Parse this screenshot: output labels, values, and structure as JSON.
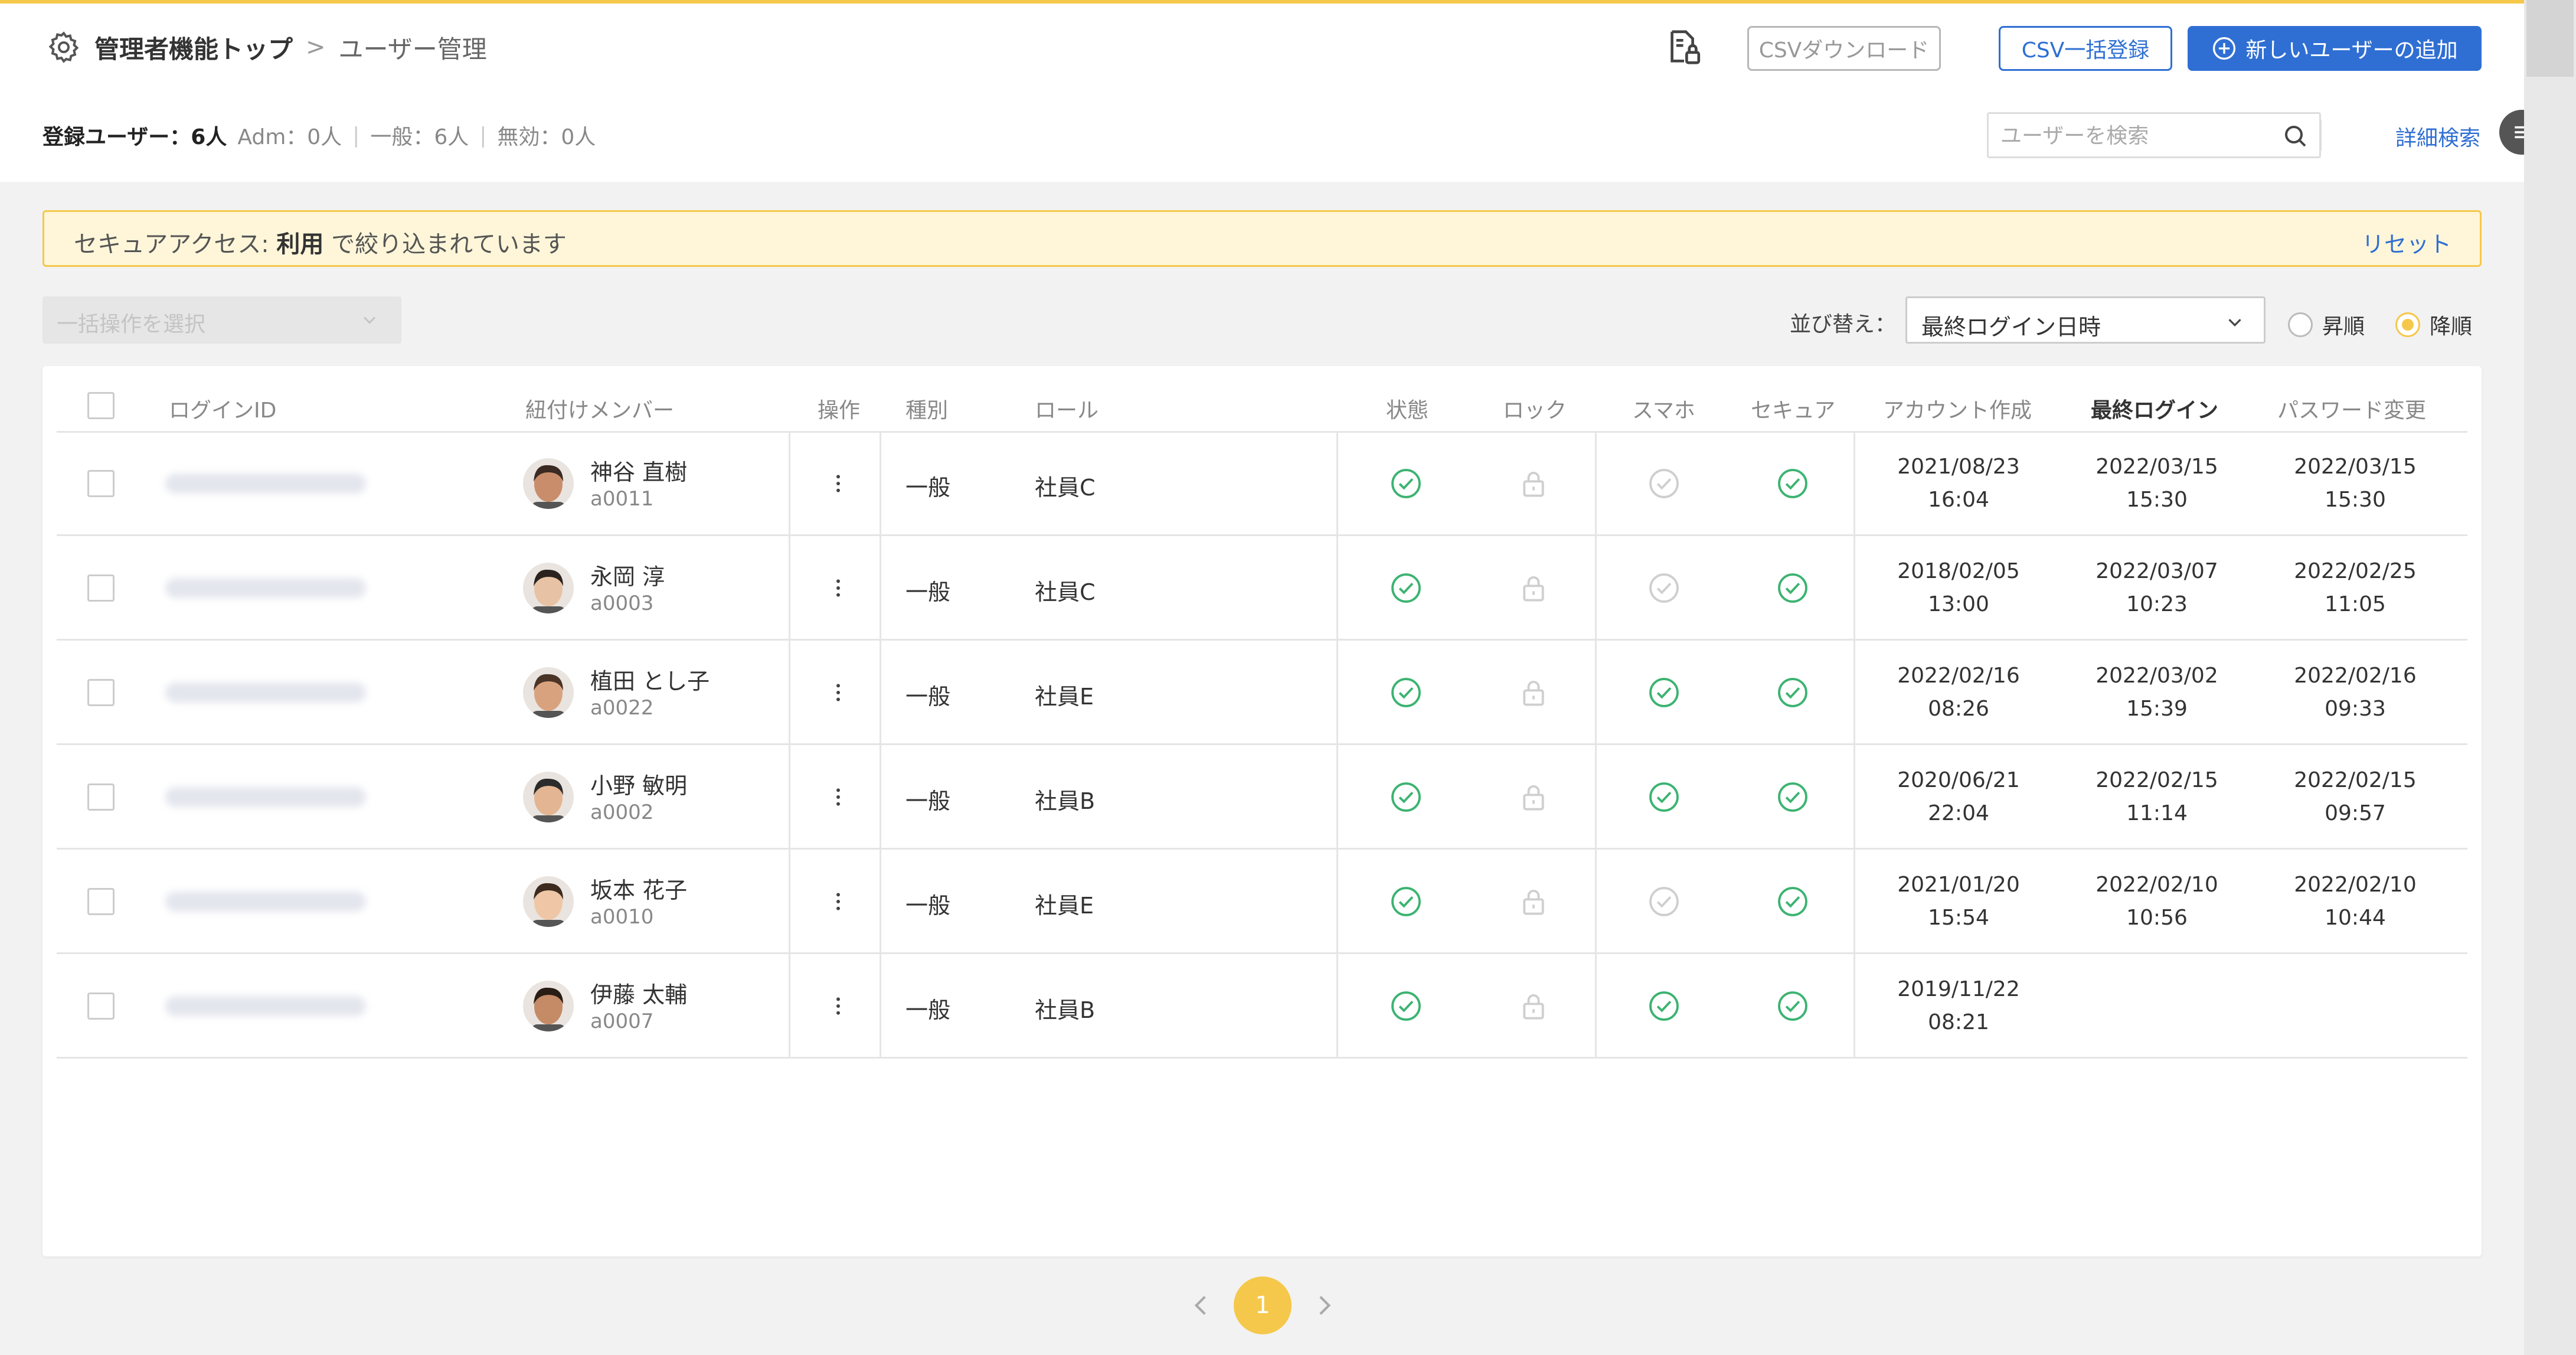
{
  "breadcrumb": {
    "home": "管理者機能トップ",
    "separator": ">",
    "current": "ユーザー管理"
  },
  "header_buttons": {
    "csv_download": "CSVダウンロード",
    "csv_bulk": "CSV一括登録",
    "add_user": "新しいユーザーの追加"
  },
  "stats": {
    "registered": "登録ユーザー：6人",
    "adm": "Adm：0人",
    "general": "一般：6人",
    "invalid": "無効：0人",
    "divider": "|"
  },
  "search": {
    "placeholder": "ユーザーを検索",
    "value": ""
  },
  "advanced_search": "詳細検索",
  "filter_banner": {
    "prefix": "セキュアアクセス: ",
    "term": "利用",
    "suffix": " で絞り込まれています",
    "reset": "リセット"
  },
  "bulk_action": {
    "placeholder": "一括操作を選択"
  },
  "sort": {
    "label": "並び替え：",
    "selected": "最終ログイン日時",
    "asc": "昇順",
    "desc": "降順",
    "active": "desc"
  },
  "columns": {
    "login_id": "ログインID",
    "member": "紐付けメンバー",
    "ops": "操作",
    "type": "種別",
    "role": "ロール",
    "status": "状態",
    "lock": "ロック",
    "phone": "スマホ",
    "secure": "セキュア",
    "created": "アカウント作成",
    "last_login": "最終ログイン",
    "pw_change": "パスワード変更"
  },
  "users": [
    {
      "name": "神谷 直樹",
      "code": "a0011",
      "type": "一般",
      "role": "社員C",
      "status": true,
      "lock": false,
      "phone": false,
      "secure": true,
      "created_date": "2021/08/23",
      "created_time": "16:04",
      "login_date": "2022/03/15",
      "login_time": "15:30",
      "pw_date": "2022/03/15",
      "pw_time": "15:30"
    },
    {
      "name": "永岡 淳",
      "code": "a0003",
      "type": "一般",
      "role": "社員C",
      "status": true,
      "lock": false,
      "phone": false,
      "secure": true,
      "created_date": "2018/02/05",
      "created_time": "13:00",
      "login_date": "2022/03/07",
      "login_time": "10:23",
      "pw_date": "2022/02/25",
      "pw_time": "11:05"
    },
    {
      "name": "植田 とし子",
      "code": "a0022",
      "type": "一般",
      "role": "社員E",
      "status": true,
      "lock": false,
      "phone": true,
      "secure": true,
      "created_date": "2022/02/16",
      "created_time": "08:26",
      "login_date": "2022/03/02",
      "login_time": "15:39",
      "pw_date": "2022/02/16",
      "pw_time": "09:33"
    },
    {
      "name": "小野 敏明",
      "code": "a0002",
      "type": "一般",
      "role": "社員B",
      "status": true,
      "lock": false,
      "phone": true,
      "secure": true,
      "created_date": "2020/06/21",
      "created_time": "22:04",
      "login_date": "2022/02/15",
      "login_time": "11:14",
      "pw_date": "2022/02/15",
      "pw_time": "09:57"
    },
    {
      "name": "坂本 花子",
      "code": "a0010",
      "type": "一般",
      "role": "社員E",
      "status": true,
      "lock": false,
      "phone": false,
      "secure": true,
      "created_date": "2021/01/20",
      "created_time": "15:54",
      "login_date": "2022/02/10",
      "login_time": "10:56",
      "pw_date": "2022/02/10",
      "pw_time": "10:44"
    },
    {
      "name": "伊藤 太輔",
      "code": "a0007",
      "type": "一般",
      "role": "社員B",
      "status": true,
      "lock": false,
      "phone": true,
      "secure": true,
      "created_date": "2019/11/22",
      "created_time": "08:21",
      "login_date": "",
      "login_time": "",
      "pw_date": "",
      "pw_time": ""
    }
  ],
  "pagination": {
    "current": "1"
  },
  "colors": {
    "accent": "#f5c84b",
    "primary": "#2f6fd3",
    "ok": "#3cb371",
    "muted": "#cfcfcf"
  }
}
